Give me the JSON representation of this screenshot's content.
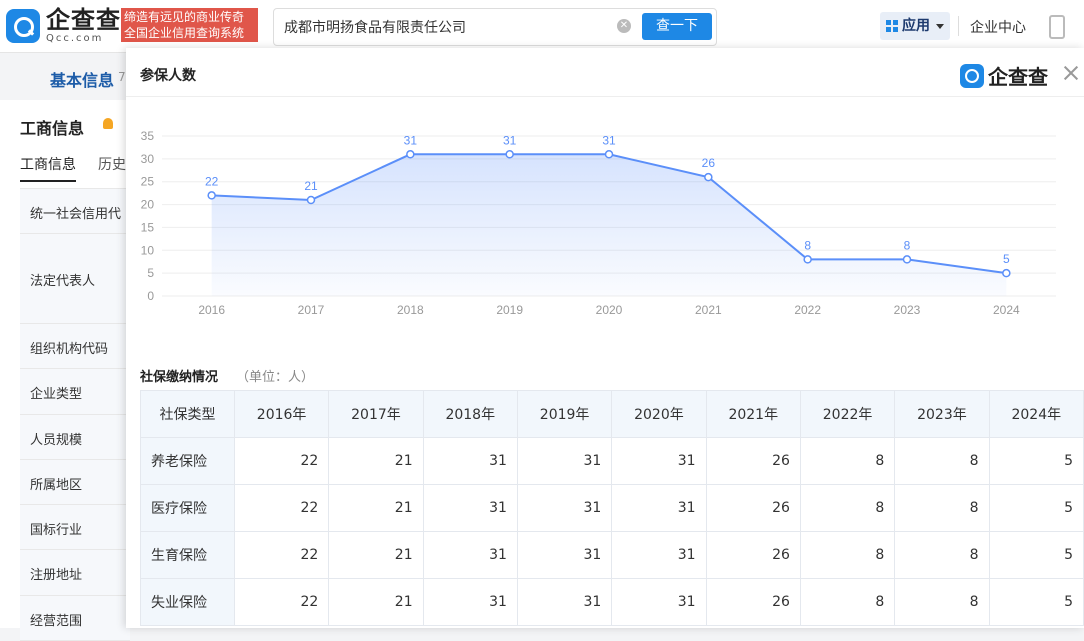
{
  "header": {
    "logo_cn": "企查查",
    "logo_en": "Qcc.com",
    "slogan_line1": "缔造有远见的商业传奇",
    "slogan_line2": "全国企业信用查询系统",
    "search_value": "成都市明扬食品有限责任公司",
    "search_button": "查一下",
    "apps_label": "应用",
    "center_link": "企业中心"
  },
  "background_page": {
    "tab_basic": "基本信息",
    "tab_basic_suffix": "7",
    "section_title": "工商信息",
    "sub_tabs": [
      "工商信息",
      "历史"
    ],
    "rows": [
      {
        "label": "统一社会信用代"
      },
      {
        "label": "法定代表人"
      },
      {
        "label": "组织机构代码"
      },
      {
        "label": "企业类型"
      },
      {
        "label": "人员规模"
      },
      {
        "label": "所属地区"
      },
      {
        "label": "国标行业"
      },
      {
        "label": "注册地址"
      },
      {
        "label": "经营范围"
      }
    ]
  },
  "modal": {
    "title": "参保人数",
    "logo_text": "企查查",
    "section_title": "社保缴纳情况",
    "section_unit": "（单位：人）"
  },
  "chart_data": {
    "type": "area",
    "title": "",
    "xlabel": "",
    "ylabel": "",
    "x": [
      "2016",
      "2017",
      "2018",
      "2019",
      "2020",
      "2021",
      "2022",
      "2023",
      "2024"
    ],
    "values": [
      22,
      21,
      31,
      31,
      31,
      26,
      8,
      8,
      5
    ],
    "ylim": [
      0,
      35
    ],
    "yticks": [
      0,
      5,
      10,
      15,
      20,
      25,
      30,
      35
    ],
    "grid": true,
    "line_color": "#5b8ff9",
    "data_labels": true
  },
  "table": {
    "columns": [
      "社保类型",
      "2016年",
      "2017年",
      "2018年",
      "2019年",
      "2020年",
      "2021年",
      "2022年",
      "2023年",
      "2024年"
    ],
    "rows": [
      {
        "type": "养老保险",
        "values": [
          "22",
          "21",
          "31",
          "31",
          "31",
          "26",
          "8",
          "8",
          "5"
        ]
      },
      {
        "type": "医疗保险",
        "values": [
          "22",
          "21",
          "31",
          "31",
          "31",
          "26",
          "8",
          "8",
          "5"
        ]
      },
      {
        "type": "生育保险",
        "values": [
          "22",
          "21",
          "31",
          "31",
          "31",
          "26",
          "8",
          "8",
          "5"
        ]
      },
      {
        "type": "失业保险",
        "values": [
          "22",
          "21",
          "31",
          "31",
          "31",
          "26",
          "8",
          "8",
          "5"
        ]
      }
    ]
  },
  "colors": {
    "brand": "#1e88e5",
    "slogan_bg": "#e0564a",
    "header_cell_bg": "#f2f7fc"
  }
}
